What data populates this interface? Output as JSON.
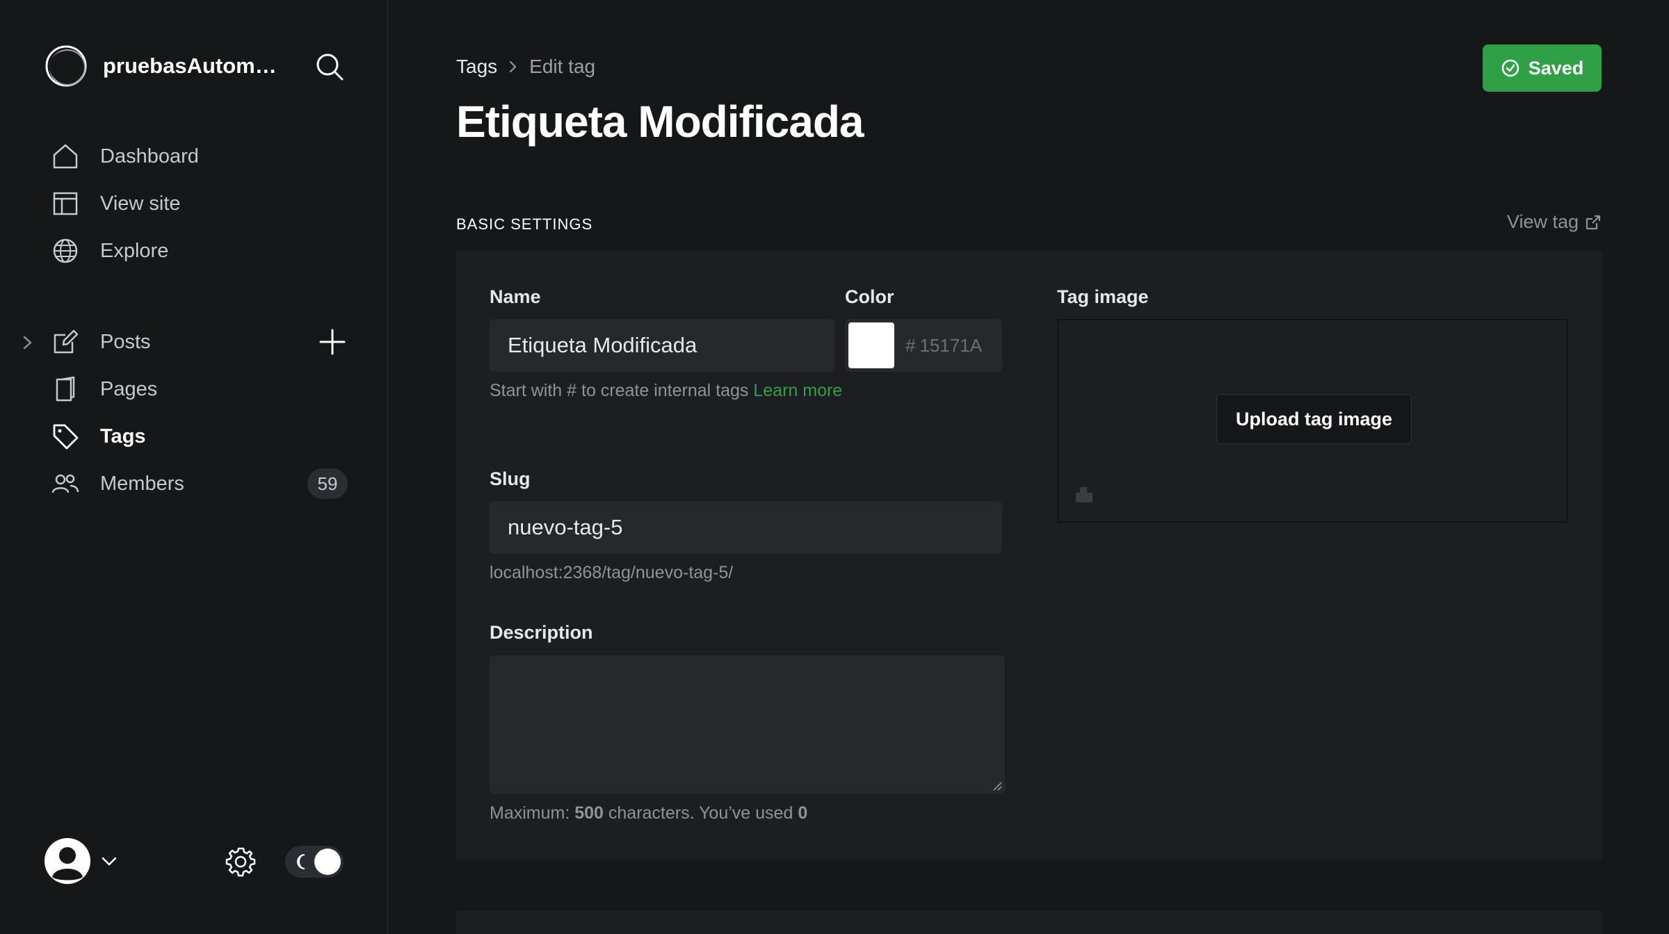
{
  "sidebar": {
    "brand_name": "pruebasAutoma...",
    "nav": [
      {
        "label": "Dashboard",
        "icon": "home-icon"
      },
      {
        "label": "View site",
        "icon": "layout-icon"
      },
      {
        "label": "Explore",
        "icon": "globe-icon"
      },
      {
        "label": "Posts",
        "icon": "edit-icon"
      },
      {
        "label": "Pages",
        "icon": "pages-icon"
      },
      {
        "label": "Tags",
        "icon": "tag-icon"
      },
      {
        "label": "Members",
        "icon": "members-icon",
        "count": "59"
      }
    ]
  },
  "header": {
    "breadcrumb_parent": "Tags",
    "breadcrumb_current": "Edit tag",
    "title": "Etiqueta Modificada",
    "saved_label": "Saved"
  },
  "basic_settings": {
    "section_label": "BASIC SETTINGS",
    "view_tag_label": "View tag",
    "name": {
      "label": "Name",
      "value": "Etiqueta Modificada",
      "hint": "Start with # to create internal tags ",
      "learn_more": "Learn more"
    },
    "color": {
      "label": "Color",
      "hash": "#",
      "placeholder": "15171A",
      "swatch_color": "#ffffff"
    },
    "slug": {
      "label": "Slug",
      "value": "nuevo-tag-5",
      "url": "localhost:2368/tag/nuevo-tag-5/"
    },
    "description": {
      "label": "Description",
      "value": "",
      "hint_prefix": "Maximum: ",
      "max": "500",
      "hint_middle": " characters. You’ve used ",
      "used": "0"
    },
    "tag_image": {
      "label": "Tag image",
      "upload_label": "Upload tag image"
    }
  },
  "colors": {
    "accent_green": "#30a046",
    "background": "#151719",
    "card": "#1c1e21"
  }
}
